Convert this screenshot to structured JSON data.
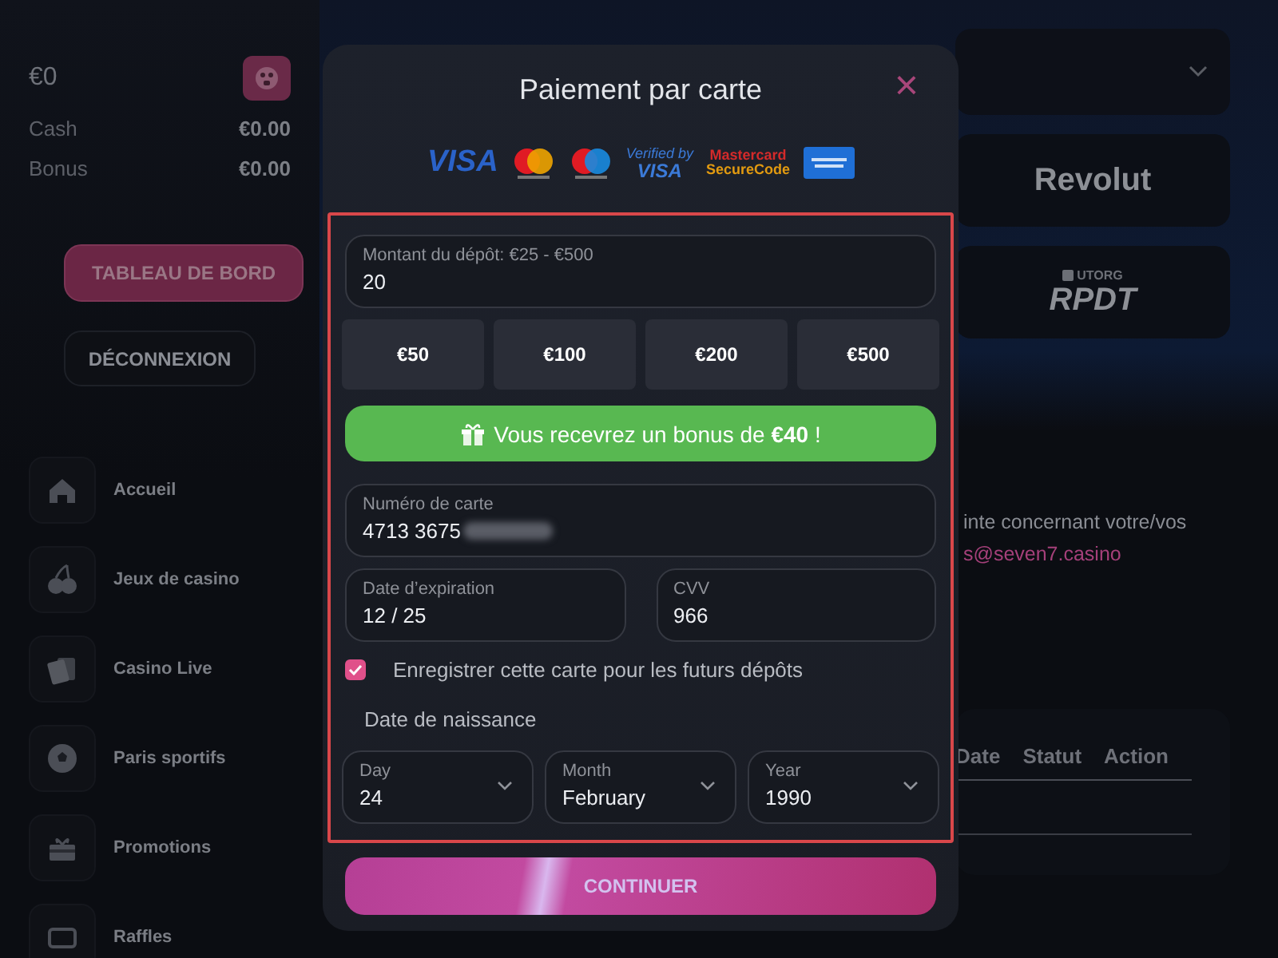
{
  "sidebar": {
    "balance": "€0",
    "rows": [
      {
        "label": "Cash",
        "value": "€0.00"
      },
      {
        "label": "Bonus",
        "value": "€0.00"
      }
    ],
    "dashboard_button": "TABLEAU DE BORD",
    "logout_button": "DÉCONNEXION",
    "nav": [
      {
        "kind": "home",
        "label": "Accueil"
      },
      {
        "kind": "cherries",
        "label": "Jeux de casino"
      },
      {
        "kind": "cards",
        "label": "Casino Live"
      },
      {
        "kind": "ball",
        "label": "Paris sportifs"
      },
      {
        "kind": "gift",
        "label": "Promotions"
      },
      {
        "kind": "ticket",
        "label": "Raffles"
      }
    ]
  },
  "main": {
    "providers": [
      {
        "kind": "revolut",
        "label": "Revolut"
      },
      {
        "kind": "utorg",
        "label": "RPDT",
        "sublabel": "UTORG"
      }
    ],
    "notice": "inte concernant votre/vos",
    "email": "s@seven7.casino",
    "table": {
      "columns": [
        "Date",
        "Statut",
        "Action"
      ]
    }
  },
  "modal": {
    "title": "Paiement par carte",
    "close": "×",
    "brands": [
      {
        "kind": "visa",
        "label": "VISA"
      },
      {
        "kind": "mastercard"
      },
      {
        "kind": "maestro"
      },
      {
        "kind": "verified",
        "label": "Verified by",
        "sublabel": "VISA"
      },
      {
        "kind": "securecode",
        "label": "Mastercard",
        "sublabel": "SecureCode"
      },
      {
        "kind": "amex"
      }
    ],
    "amount": {
      "label": "Montant du dépôt: €25 - €500",
      "value": "20"
    },
    "quick_amounts": [
      "€50",
      "€100",
      "€200",
      "€500"
    ],
    "bonus": "Vous recevrez un bonus de **€40** !",
    "card_number": {
      "label": "Numéro de carte",
      "value": "4713 3675"
    },
    "expiry": {
      "label": "Date d’expiration",
      "value": "12 / 25"
    },
    "cvv": {
      "label": "CVV",
      "value": "966"
    },
    "save_card": {
      "label": "Enregistrer cette carte pour les futurs dépôts",
      "checked": true
    },
    "birth_date_label": "Date de naissance",
    "birth_date": [
      {
        "label": "Day",
        "value": "24"
      },
      {
        "label": "Month",
        "value": "February"
      },
      {
        "label": "Year",
        "value": "1990"
      }
    ],
    "continue_button": "CONTINUER"
  }
}
